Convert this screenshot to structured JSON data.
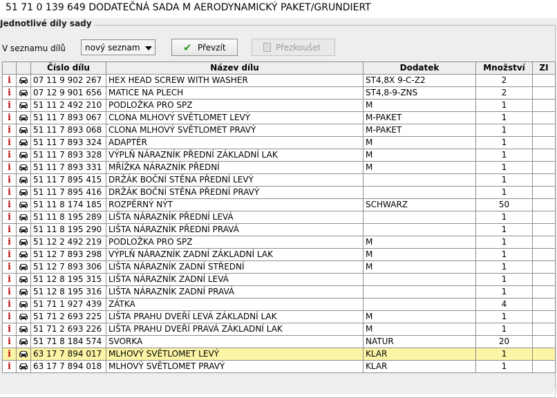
{
  "window": {
    "title": "51 71 0 139 649 DODATEČNÁ SADA M AERODYNAMICKÝ PAKET/GRUNDIERT"
  },
  "group": {
    "title": "Jednotlivé díly sady"
  },
  "toolbar": {
    "list_label": "V seznamu dílů",
    "list_select_value": "nový seznam",
    "take_button": "Převzít",
    "take_icon": "check-icon",
    "check_button": "Přezkoušet",
    "check_icon": "document-icon"
  },
  "table": {
    "headers": {
      "part_number": "Číslo dílu",
      "part_name": "Název dílu",
      "addition": "Dodatek",
      "quantity": "Množství",
      "zi": "ZI"
    },
    "row_icons": {
      "info": "info-icon",
      "vehicle": "car-icon"
    },
    "info_glyph": "i",
    "selected_row_color": "#fbf5a5",
    "rows": [
      {
        "part_number": "07 11 9 902 267",
        "name": "HEX HEAD SCREW WITH WASHER",
        "addition": "ST4,8X 9-C-Z2",
        "quantity": "2",
        "zi": "",
        "selected": false
      },
      {
        "part_number": "07 12 9 901 656",
        "name": "MATICE NA PLECH",
        "addition": "ST4,8-9-ZNS",
        "quantity": "2",
        "zi": "",
        "selected": false
      },
      {
        "part_number": "51 11 2 492 210",
        "name": "PODLOŽKA PRO SPZ",
        "addition": "M",
        "quantity": "1",
        "zi": "",
        "selected": false
      },
      {
        "part_number": "51 11 7 893 067",
        "name": "CLONA MLHOVÝ SVĚTLOMET LEVÝ",
        "addition": "M-PAKET",
        "quantity": "1",
        "zi": "",
        "selected": false
      },
      {
        "part_number": "51 11 7 893 068",
        "name": "CLONA MLHOVÝ SVĚTLOMET PRAVÝ",
        "addition": "M-PAKET",
        "quantity": "1",
        "zi": "",
        "selected": false
      },
      {
        "part_number": "51 11 7 893 324",
        "name": "ADAPTÉR",
        "addition": "M",
        "quantity": "1",
        "zi": "",
        "selected": false
      },
      {
        "part_number": "51 11 7 893 328",
        "name": "VÝPLŇ NÁRAZNÍK PŘEDNÍ ZÁKLADNÍ LAK",
        "addition": "M",
        "quantity": "1",
        "zi": "",
        "selected": false
      },
      {
        "part_number": "51 11 7 893 331",
        "name": "MŘÍŽKA NÁRAZNÍK PŘEDNÍ",
        "addition": "M",
        "quantity": "1",
        "zi": "",
        "selected": false
      },
      {
        "part_number": "51 11 7 895 415",
        "name": "DRŽÁK BOČNÍ STĚNA PŘEDNÍ LEVÝ",
        "addition": "",
        "quantity": "1",
        "zi": "",
        "selected": false
      },
      {
        "part_number": "51 11 7 895 416",
        "name": "DRŽÁK BOČNÍ STĚNA PŘEDNÍ PRAVÝ",
        "addition": "",
        "quantity": "1",
        "zi": "",
        "selected": false
      },
      {
        "part_number": "51 11 8 174 185",
        "name": "ROZPĚRNÝ NÝT",
        "addition": "SCHWARZ",
        "quantity": "50",
        "zi": "",
        "selected": false
      },
      {
        "part_number": "51 11 8 195 289",
        "name": "LIŠTA NÁRAZNÍK PŘEDNÍ LEVÁ",
        "addition": "",
        "quantity": "1",
        "zi": "",
        "selected": false
      },
      {
        "part_number": "51 11 8 195 290",
        "name": "LIŠTA NÁRAZNÍK PŘEDNÍ PRAVÁ",
        "addition": "",
        "quantity": "1",
        "zi": "",
        "selected": false
      },
      {
        "part_number": "51 12 2 492 219",
        "name": "PODLOŽKA PRO SPZ",
        "addition": "M",
        "quantity": "1",
        "zi": "",
        "selected": false
      },
      {
        "part_number": "51 12 7 893 298",
        "name": "VÝPLŇ NÁRAZNÍK ZADNÍ ZÁKLADNÍ LAK",
        "addition": "M",
        "quantity": "1",
        "zi": "",
        "selected": false
      },
      {
        "part_number": "51 12 7 893 306",
        "name": "LIŠTA NÁRAZNÍK ZADNÍ STŘEDNÍ",
        "addition": "M",
        "quantity": "1",
        "zi": "",
        "selected": false
      },
      {
        "part_number": "51 12 8 195 315",
        "name": "LIŠTA NÁRAZNÍK ZADNÍ LEVÁ",
        "addition": "",
        "quantity": "1",
        "zi": "",
        "selected": false
      },
      {
        "part_number": "51 12 8 195 316",
        "name": "LIŠTA NÁRAZNÍK ZADNÍ PRAVÁ",
        "addition": "",
        "quantity": "1",
        "zi": "",
        "selected": false
      },
      {
        "part_number": "51 71 1 927 439",
        "name": "ZÁTKA",
        "addition": "",
        "quantity": "4",
        "zi": "",
        "selected": false
      },
      {
        "part_number": "51 71 2 693 225",
        "name": "LIŠTA PRAHU DVEŘÍ LEVÁ ZÁKLADNÍ LAK",
        "addition": "M",
        "quantity": "1",
        "zi": "",
        "selected": false
      },
      {
        "part_number": "51 71 2 693 226",
        "name": "LIŠTA PRAHU DVEŘÍ PRAVÁ ZÁKLADNÍ LAK",
        "addition": "M",
        "quantity": "1",
        "zi": "",
        "selected": false
      },
      {
        "part_number": "51 71 8 184 574",
        "name": "SVORKA",
        "addition": "NATUR",
        "quantity": "20",
        "zi": "",
        "selected": false
      },
      {
        "part_number": "63 17 7 894 017",
        "name": "MLHOVÝ SVĚTLOMET LEVÝ",
        "addition": "KLAR",
        "quantity": "1",
        "zi": "",
        "selected": true
      },
      {
        "part_number": "63 17 7 894 018",
        "name": "MLHOVÝ SVĚTLOMET PRAVÝ",
        "addition": "KLAR",
        "quantity": "1",
        "zi": "",
        "selected": false
      }
    ]
  }
}
